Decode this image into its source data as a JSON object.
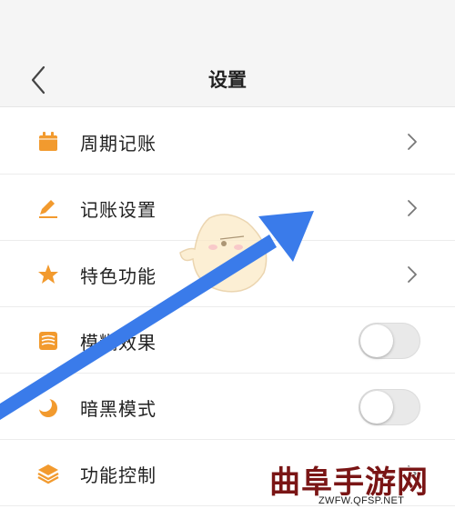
{
  "header": {
    "title": "设置",
    "back_icon": "chevron-left-icon"
  },
  "items": [
    {
      "label": "周期记账",
      "icon": "calendar-icon",
      "control": "chevron"
    },
    {
      "label": "记账设置",
      "icon": "pen-icon",
      "control": "chevron"
    },
    {
      "label": "特色功能",
      "icon": "star-icon",
      "control": "chevron"
    },
    {
      "label": "模糊效果",
      "icon": "layers-blur-icon",
      "control": "toggle",
      "on": false
    },
    {
      "label": "暗黑模式",
      "icon": "moon-icon",
      "control": "toggle",
      "on": false
    },
    {
      "label": "功能控制",
      "icon": "stack-icon",
      "control": "chevron"
    }
  ],
  "colors": {
    "accent": "#f29a2e",
    "arrow": "#3a7bea",
    "watermark": "#7a1515"
  },
  "watermark": {
    "text": "曲阜手游网",
    "url": "ZWFW.QFSP.NET"
  }
}
